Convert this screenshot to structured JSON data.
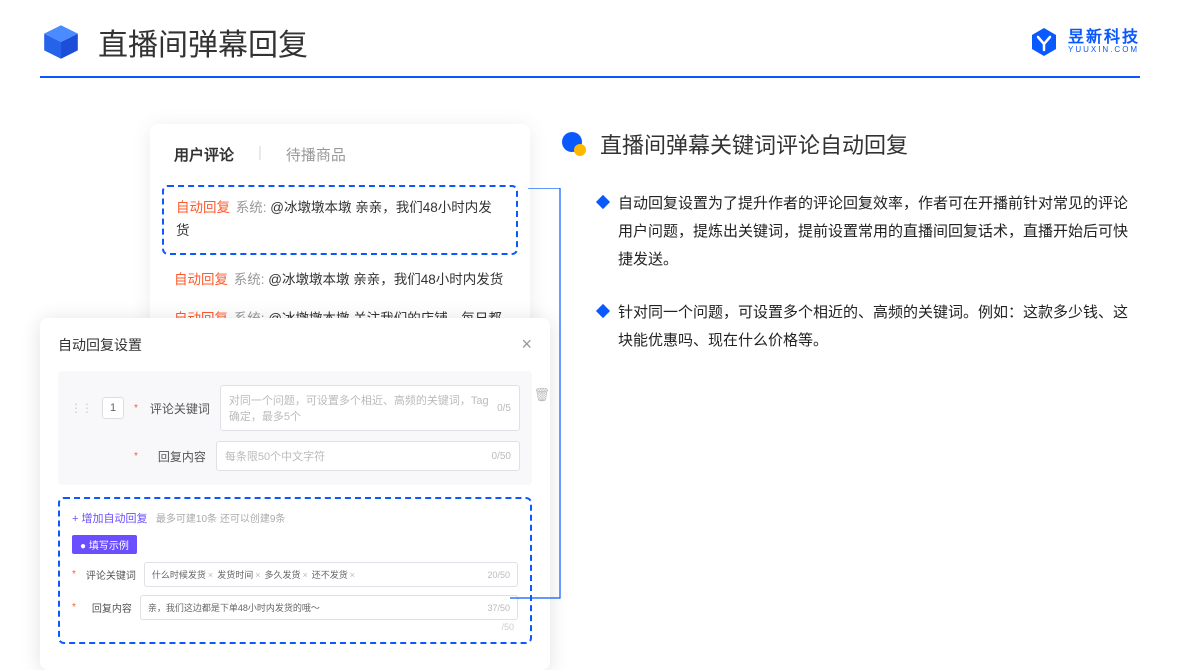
{
  "header": {
    "title": "直播间弹幕回复",
    "brand_cn": "昱新科技",
    "brand_en": "YUUXIN.COM"
  },
  "comments": {
    "tabs": {
      "active": "用户评论",
      "inactive": "待播商品"
    },
    "list": [
      {
        "auto": "自动回复",
        "sys": "系统:",
        "text": "@冰墩墩本墩 亲亲，我们48小时内发货",
        "hl": true
      },
      {
        "auto": "自动回复",
        "sys": "系统:",
        "text": "@冰墩墩本墩 亲亲，我们48小时内发货"
      },
      {
        "auto": "自动回复",
        "sys": "系统:",
        "text": "@冰墩墩本墩 关注我们的店铺，每日都有热门推荐哟～"
      }
    ]
  },
  "settings": {
    "title": "自动回复设置",
    "idx": "1",
    "kw_label": "评论关键词",
    "kw_placeholder": "对同一个问题，可设置多个相近、高频的关键词，Tag确定，最多5个",
    "kw_count": "0/5",
    "content_label": "回复内容",
    "content_placeholder": "每条限50个中文字符",
    "content_count": "0/50",
    "add_link": "+ 增加自动回复",
    "add_hint": "最多可建10条 还可以创建9条",
    "example_badge": "● 填写示例",
    "ex_kw_label": "评论关键词",
    "ex_tags": [
      "什么时候发货",
      "发货时间",
      "多久发货",
      "还不发货"
    ],
    "ex_kw_count": "20/50",
    "ex_content_label": "回复内容",
    "ex_content_text": "亲，我们这边都是下单48小时内发货的哦～",
    "ex_content_count": "37/50",
    "outer_count": "/50"
  },
  "right": {
    "title": "直播间弹幕关键词评论自动回复",
    "bullets": [
      "自动回复设置为了提升作者的评论回复效率，作者可在开播前针对常见的评论用户问题，提炼出关键词，提前设置常用的直播间回复话术，直播开始后可快捷发送。",
      "针对同一个问题，可设置多个相近的、高频的关键词。例如：这款多少钱、这块能优惠吗、现在什么价格等。"
    ]
  }
}
